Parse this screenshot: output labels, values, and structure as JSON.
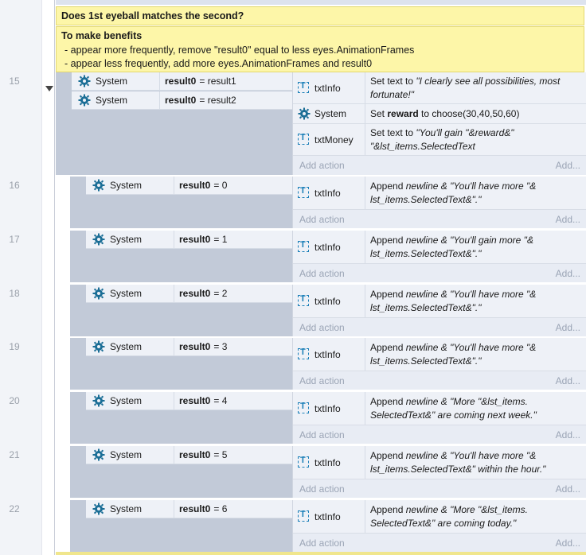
{
  "comments": {
    "question": "Does 1st eyeball matches the second?",
    "benefits_title": "To make benefits",
    "benefit_lines": [
      "- appear more frequently, remove \"result0\" equal to less eyes.AnimationFrames",
      "- appear less frequently, add more eyes.AnimationFrames and result0"
    ]
  },
  "add_action_label": "Add action",
  "add_more_label": "Add...",
  "events": [
    {
      "number": "15",
      "conditions": [
        {
          "object": "System",
          "var": "result0",
          "expr": "= result1"
        },
        {
          "object": "System",
          "var": "result0",
          "expr": "= result2"
        }
      ],
      "actions": [
        {
          "object": "txtInfo",
          "icon": "text-object-icon",
          "prefix": "Set text to ",
          "text": "\"I clearly see all possibilities, most fortunate!\""
        },
        {
          "object": "System",
          "icon": "gear-icon",
          "prefix": "Set ",
          "bold": "reward",
          "text": " to choose(30,40,50,60)"
        },
        {
          "object": "txtMoney",
          "icon": "text-object-icon",
          "prefix": "Set text to ",
          "text": "\"You'll gain \"&reward&\" \"&lst_items.SelectedText"
        }
      ]
    },
    {
      "number": "16",
      "conditions": [
        {
          "object": "System",
          "var": "result0",
          "expr": "= 0"
        }
      ],
      "actions": [
        {
          "object": "txtInfo",
          "icon": "text-object-icon",
          "prefix": "Append ",
          "text": "newline & \"You'll have more \"& lst_items.SelectedText&\".\""
        }
      ]
    },
    {
      "number": "17",
      "conditions": [
        {
          "object": "System",
          "var": "result0",
          "expr": "= 1"
        }
      ],
      "actions": [
        {
          "object": "txtInfo",
          "icon": "text-object-icon",
          "prefix": "Append ",
          "text": "newline & \"You'll gain more \"& lst_items.SelectedText&\".\""
        }
      ]
    },
    {
      "number": "18",
      "conditions": [
        {
          "object": "System",
          "var": "result0",
          "expr": "= 2"
        }
      ],
      "actions": [
        {
          "object": "txtInfo",
          "icon": "text-object-icon",
          "prefix": "Append ",
          "text": "newline & \"You'll have more \"& lst_items.SelectedText&\".\""
        }
      ]
    },
    {
      "number": "19",
      "conditions": [
        {
          "object": "System",
          "var": "result0",
          "expr": "= 3"
        }
      ],
      "actions": [
        {
          "object": "txtInfo",
          "icon": "text-object-icon",
          "prefix": "Append ",
          "text": "newline & \"You'll have more \"& lst_items.SelectedText&\".\""
        }
      ]
    },
    {
      "number": "20",
      "conditions": [
        {
          "object": "System",
          "var": "result0",
          "expr": "= 4"
        }
      ],
      "actions": [
        {
          "object": "txtInfo",
          "icon": "text-object-icon",
          "prefix": "Append ",
          "text": "newline & \"More \"&lst_items. SelectedText&\" are coming next week.\""
        }
      ]
    },
    {
      "number": "21",
      "conditions": [
        {
          "object": "System",
          "var": "result0",
          "expr": "= 5"
        }
      ],
      "actions": [
        {
          "object": "txtInfo",
          "icon": "text-object-icon",
          "prefix": "Append ",
          "text": "newline & \"You'll have more \"& lst_items.SelectedText&\" within the hour.\""
        }
      ]
    },
    {
      "number": "22",
      "conditions": [
        {
          "object": "System",
          "var": "result0",
          "expr": "= 6"
        }
      ],
      "actions": [
        {
          "object": "txtInfo",
          "icon": "text-object-icon",
          "prefix": "Append ",
          "text": "newline & \"More \"&lst_items. SelectedText&\" are coming today.\""
        }
      ]
    }
  ]
}
